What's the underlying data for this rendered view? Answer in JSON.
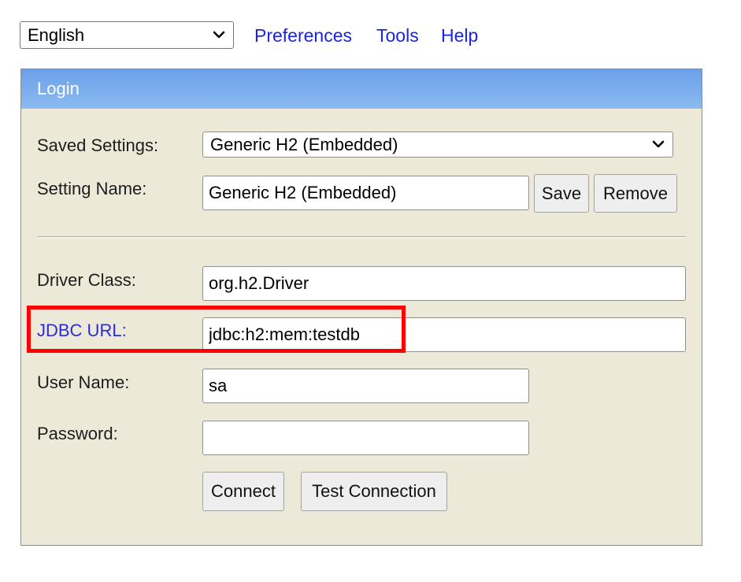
{
  "language": {
    "selected": "English"
  },
  "nav": {
    "preferences": "Preferences",
    "tools": "Tools",
    "help": "Help"
  },
  "login": {
    "title": "Login",
    "saved_settings_label": "Saved Settings:",
    "saved_settings_value": "Generic H2 (Embedded)",
    "setting_name_label": "Setting Name:",
    "setting_name_value": "Generic H2 (Embedded)",
    "save_label": "Save",
    "remove_label": "Remove",
    "driver_class_label": "Driver Class:",
    "driver_class_value": "org.h2.Driver",
    "jdbc_url_label": "JDBC URL:",
    "jdbc_url_value": "jdbc:h2:mem:testdb",
    "user_name_label": "User Name:",
    "user_name_value": "sa",
    "password_label": "Password:",
    "password_value": "",
    "connect_label": "Connect",
    "test_connection_label": "Test Connection"
  },
  "colors": {
    "header_gradient_start": "#6ba0e8",
    "header_gradient_end": "#8cbaf1",
    "panel_background": "#ece9d8",
    "link": "#1a25e0",
    "jdbc_label": "#2b2bd9",
    "highlight": "#ff0000"
  },
  "icons": {
    "select_arrow": "chevron-down-icon"
  }
}
